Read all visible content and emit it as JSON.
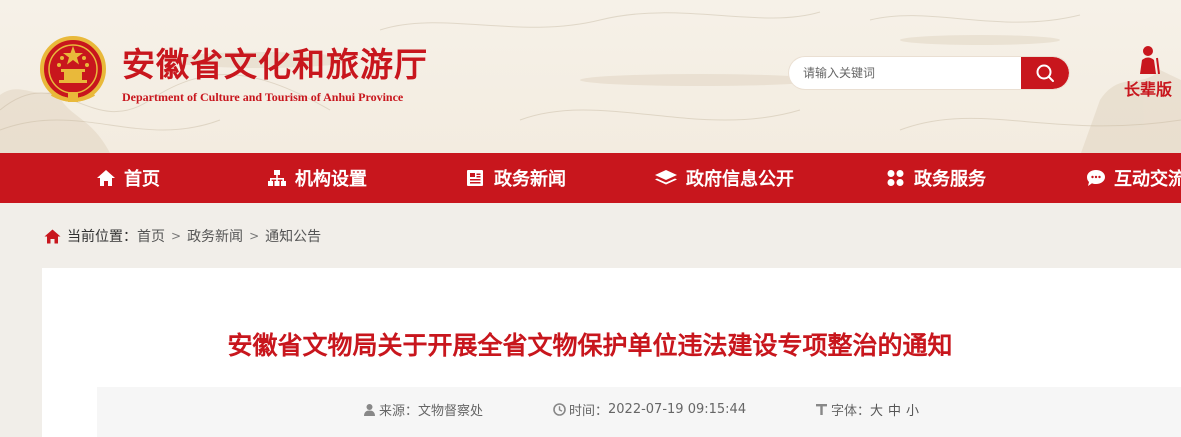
{
  "header": {
    "title": "安徽省文化和旅游厅",
    "subtitle": "Department of Culture and Tourism of Anhui Province",
    "search": {
      "placeholder": "请输入关键词",
      "value": ""
    },
    "elder_mode_label": "长辈版"
  },
  "nav": {
    "items": [
      {
        "label": "首页",
        "icon": "home-icon"
      },
      {
        "label": "机构设置",
        "icon": "org-chart-icon"
      },
      {
        "label": "政务新闻",
        "icon": "news-icon"
      },
      {
        "label": "政府信息公开",
        "icon": "layers-icon"
      },
      {
        "label": "政务服务",
        "icon": "grid-icon"
      },
      {
        "label": "互动交流",
        "icon": "chat-icon"
      }
    ]
  },
  "breadcrumb": {
    "prefix": "当前位置：",
    "items": [
      "首页",
      "政务新闻",
      "通知公告"
    ],
    "separator": ">"
  },
  "article": {
    "title": "安徽省文物局关于开展全省文物保护单位违法建设专项整治的通知",
    "source_label": "来源：",
    "source": "文物督察处",
    "time_label": "时间：",
    "time": "2022-07-19 09:15:44",
    "font_label": "字体：",
    "font_sizes": [
      "大",
      "中",
      "小"
    ]
  },
  "colors": {
    "brand_red": "#c8161d",
    "page_bg": "#f1eee9",
    "header_bg": "#f6f1e8"
  }
}
